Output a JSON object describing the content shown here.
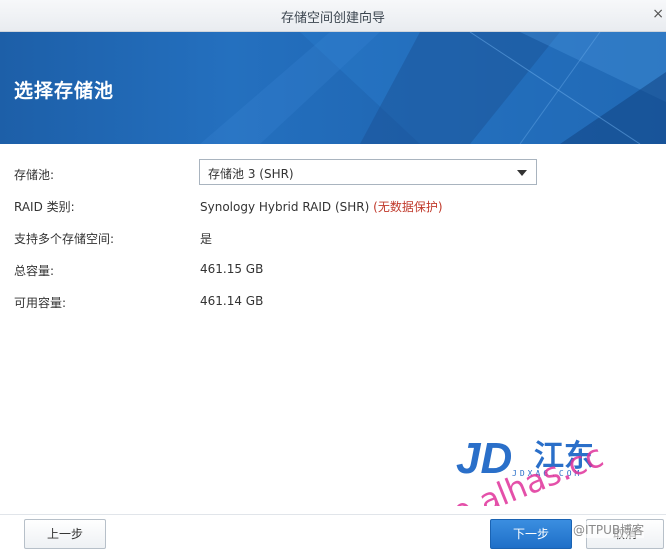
{
  "window": {
    "title": "存储空间创建向导",
    "close_glyph": "×"
  },
  "banner": {
    "heading": "选择存储池"
  },
  "form": {
    "pool_label": "存储池:",
    "pool_value": "存储池 3 (SHR)",
    "raid_label": "RAID 类别:",
    "raid_value": "Synology Hybrid RAID (SHR)",
    "raid_note": "(无数据保护)",
    "multi_label": "支持多个存储空间:",
    "multi_value": "是",
    "total_label": "总容量:",
    "total_value": "461.15 GB",
    "avail_label": "可用容量:",
    "avail_value": "461.14 GB"
  },
  "watermark": {
    "logo_letters": "JD",
    "logo_cn": "江东",
    "logo_site": "JDXA6.COM",
    "overlay": "wp.alhas.cc"
  },
  "buttons": {
    "prev": "上一步",
    "next": "下一步",
    "cancel": "取消"
  },
  "credit": "@ITPUB博客",
  "colors": {
    "banner": "#1d5fa8",
    "primary_button": "#2a7bd4",
    "warning_text": "#c0392b"
  }
}
